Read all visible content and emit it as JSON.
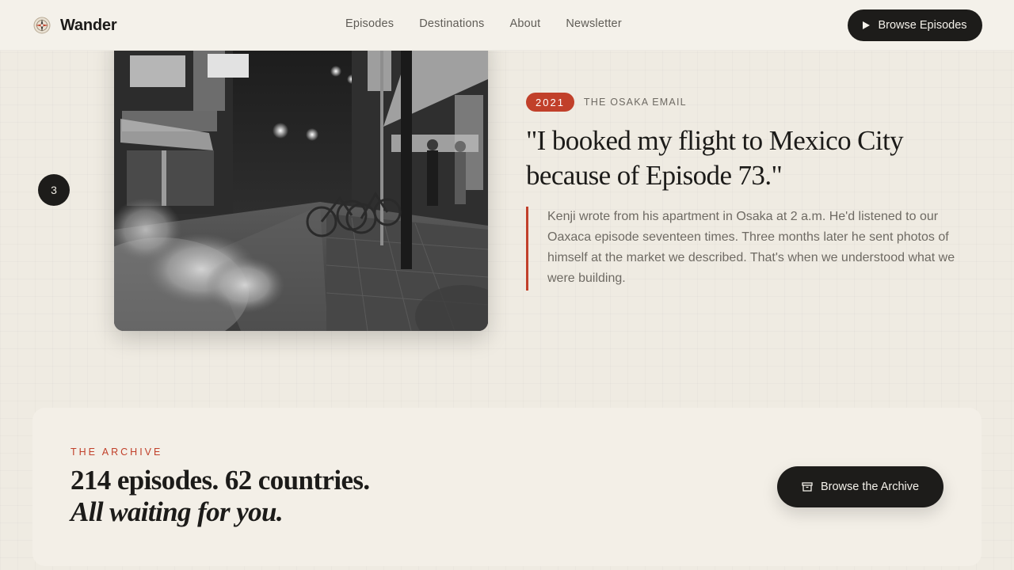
{
  "header": {
    "brand": "Wander",
    "nav": [
      "Episodes",
      "Destinations",
      "About",
      "Newsletter"
    ],
    "cta_label": "Browse Episodes"
  },
  "story": {
    "step": "3",
    "year": "2021",
    "label": "THE OSAKA EMAIL",
    "quote": "\"I booked my flight to Mexico City because of Episode 73.\"",
    "body": "Kenji wrote from his apartment in Osaka at 2 a.m. He'd listened to our Oaxaca episode seventeen times. Three months later he sent photos of himself at the market we described. That's when we understood what we were building."
  },
  "archive": {
    "eyebrow": "THE ARCHIVE",
    "title_line1": "214 episodes. 62 countries.",
    "title_line2": "All waiting for you.",
    "button_label": "Browse the Archive"
  },
  "colors": {
    "accent": "#c1402a",
    "dark": "#1d1c1a",
    "background": "#efebe2"
  },
  "icons": {
    "brand": "compass-icon",
    "cta": "play-icon",
    "archive": "archive-box-icon"
  }
}
